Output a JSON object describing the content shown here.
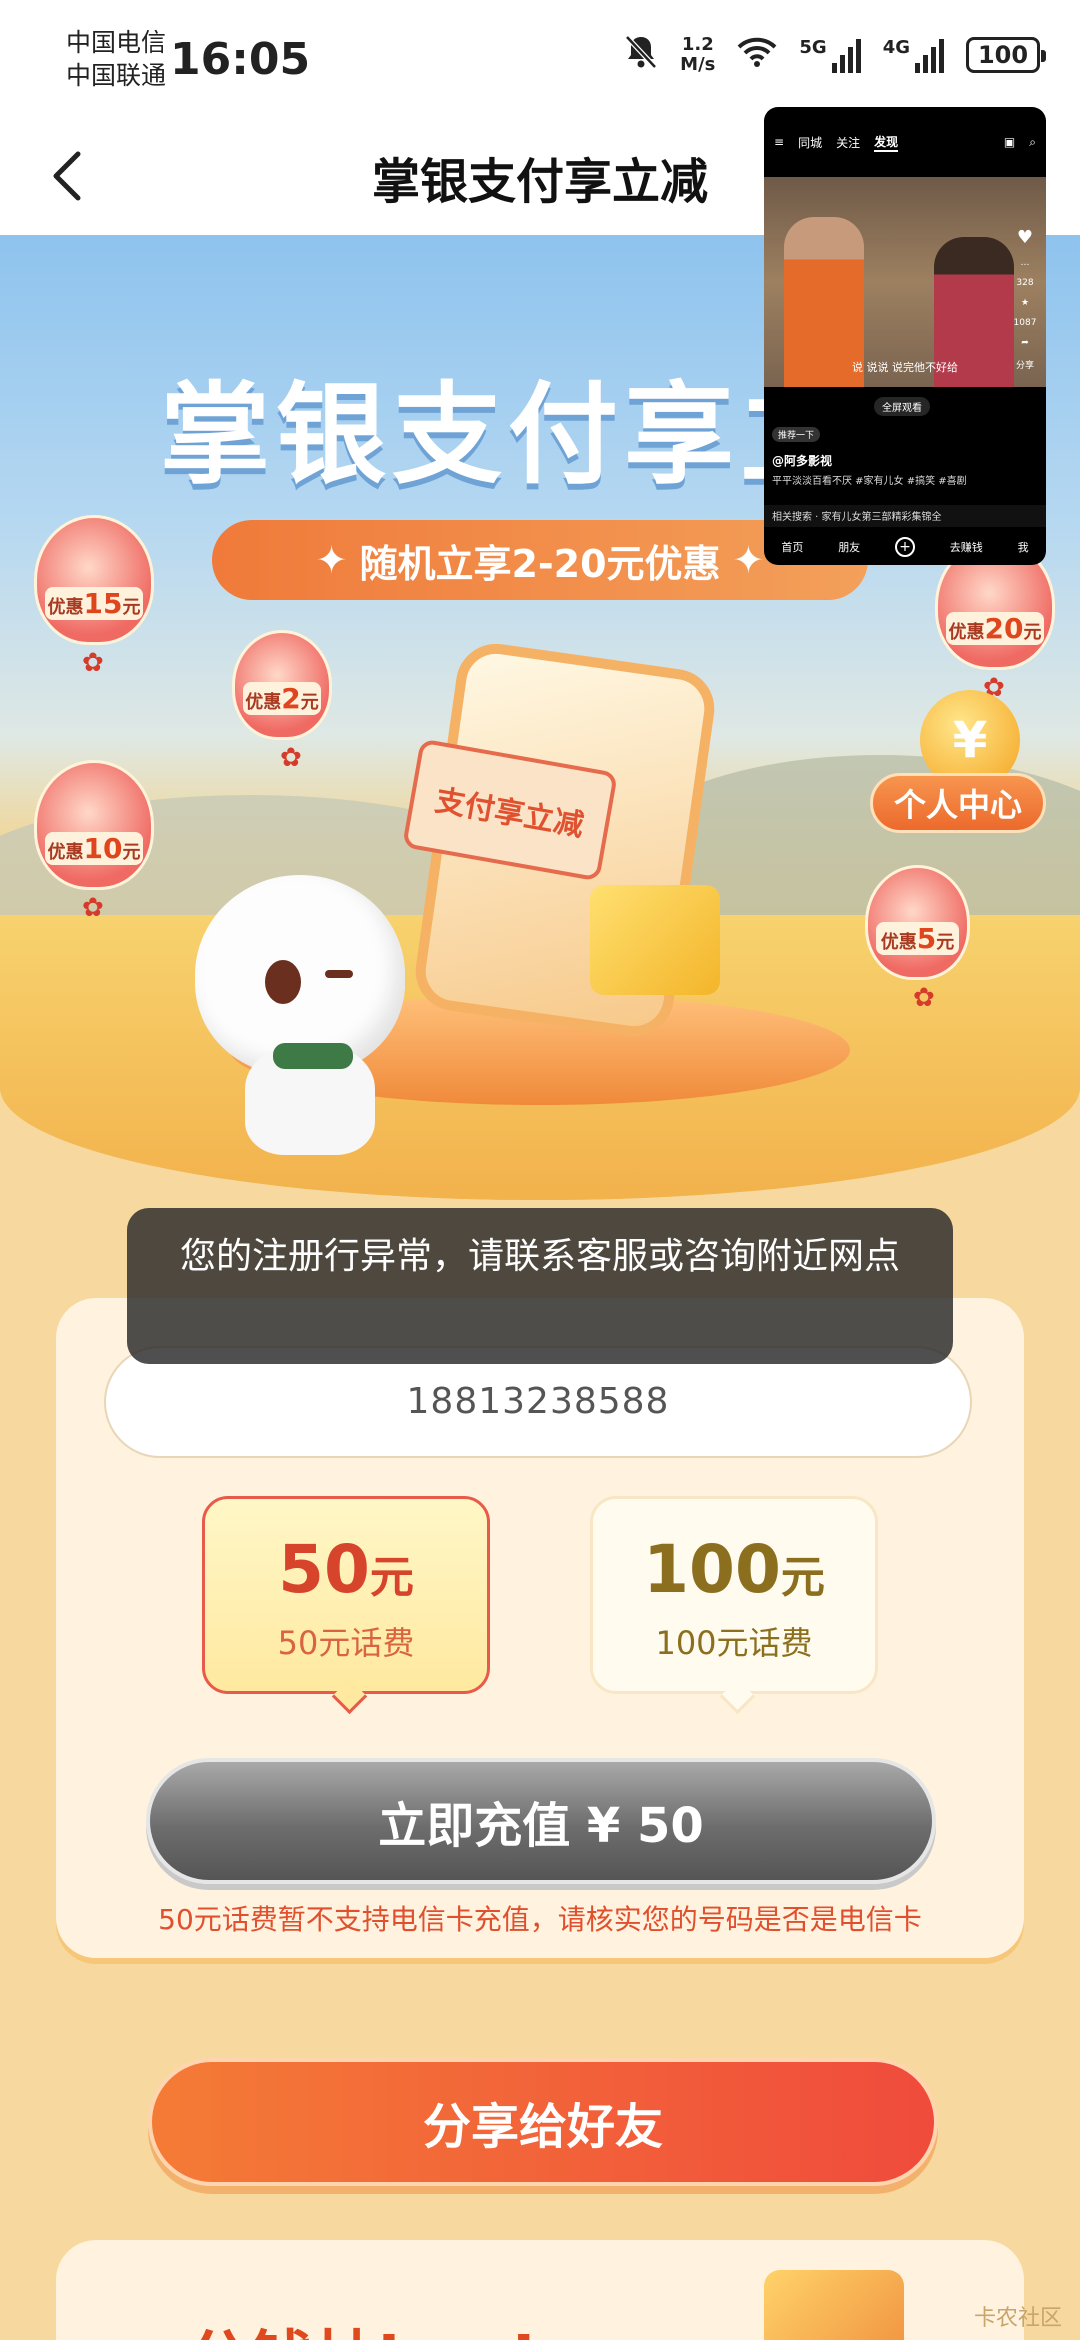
{
  "status_bar": {
    "carrier_1": "中国电信",
    "carrier_2": "中国联通",
    "time": "16:05",
    "net_speed_value": "1.2",
    "net_speed_unit": "M/s",
    "sig1_label": "5G",
    "sig2_label": "4G",
    "battery": "100"
  },
  "nav": {
    "title": "掌银支付享立减"
  },
  "hero": {
    "title": "掌银支付享立",
    "banner": "随机立享2-20元优惠",
    "coupon_text": "支付享立减",
    "user_center": "个人中心",
    "coin_symbol": "¥",
    "lanterns": [
      {
        "prefix": "优惠",
        "amount": "15",
        "unit": "元"
      },
      {
        "prefix": "优惠",
        "amount": "2",
        "unit": "元"
      },
      {
        "prefix": "优惠",
        "amount": "10",
        "unit": "元"
      },
      {
        "prefix": "优惠",
        "amount": "20",
        "unit": "元"
      },
      {
        "prefix": "优惠",
        "amount": "5",
        "unit": "元"
      }
    ]
  },
  "toast": {
    "message": "您的注册行异常，请联系客服或咨询附近网点"
  },
  "recharge": {
    "phone_number": "18813238588",
    "options": [
      {
        "amount": "50",
        "unit": "元",
        "desc": "50元话费",
        "selected": true
      },
      {
        "amount": "100",
        "unit": "元",
        "desc": "100元话费",
        "selected": false
      }
    ],
    "button": "立即充值 ¥ 50",
    "notice": "50元话费暂不支持电信卡充值，请核实您的号码是否是电信卡"
  },
  "share": {
    "button": "分享给好友"
  },
  "promo": {
    "title": "一分钱抽ipad"
  },
  "watermark": "卡农社区",
  "floating_window": {
    "tabs": [
      "同城",
      "关注",
      "发现"
    ],
    "active_tab": "发现",
    "subtitle": "说 说说 说完他不好给",
    "full_screen": "全屏观看",
    "recommend": "推荐一下",
    "author": "@阿多影视",
    "description": "平平淡淡百看不厌 #家有儿女 #搞笑 #喜剧",
    "search": "相关搜索 · 家有儿女第三部精彩集锦全",
    "like_count": "",
    "comment_count": "328",
    "fav_count": "1087",
    "share_label": "分享",
    "bottom_tabs": [
      "首页",
      "朋友",
      "+",
      "去赚钱",
      "我"
    ]
  }
}
